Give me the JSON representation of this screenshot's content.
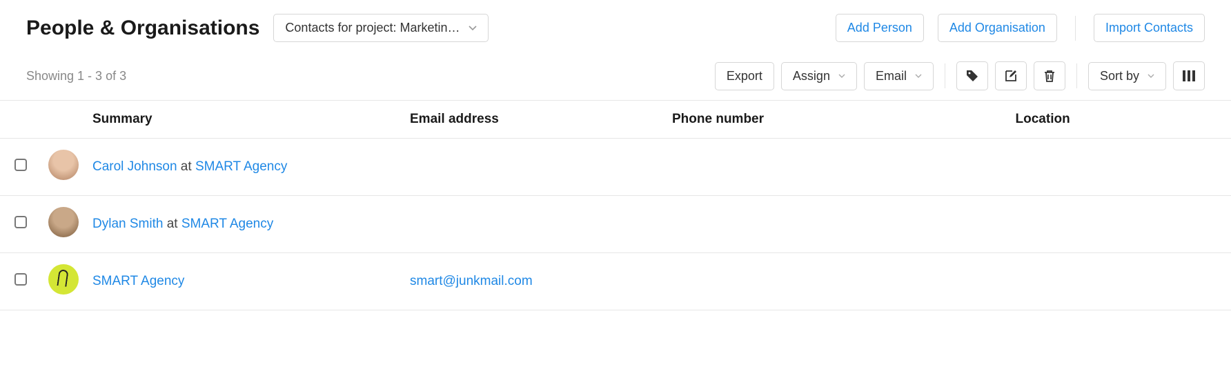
{
  "header": {
    "title": "People & Organisations",
    "filter_label": "Contacts for project: Marketin…",
    "add_person": "Add Person",
    "add_organisation": "Add Organisation",
    "import_contacts": "Import Contacts"
  },
  "toolbar": {
    "showing": "Showing 1 - 3 of 3",
    "export": "Export",
    "assign": "Assign",
    "email": "Email",
    "sort_by": "Sort by"
  },
  "columns": {
    "summary": "Summary",
    "email": "Email address",
    "phone": "Phone number",
    "location": "Location"
  },
  "rows": [
    {
      "type": "person",
      "name": "Carol Johnson",
      "at_word": "at",
      "org": "SMART Agency",
      "email": "",
      "phone": "",
      "location": "",
      "avatar_bg": "#e8c4a8",
      "avatar_bg2": "#b08060"
    },
    {
      "type": "person",
      "name": "Dylan Smith",
      "at_word": "at",
      "org": "SMART Agency",
      "email": "",
      "phone": "",
      "location": "",
      "avatar_bg": "#c9a888",
      "avatar_bg2": "#7a5a3a"
    },
    {
      "type": "org",
      "name": "SMART Agency",
      "at_word": "",
      "org": "",
      "email": "smart@junkmail.com",
      "phone": "",
      "location": ""
    }
  ]
}
